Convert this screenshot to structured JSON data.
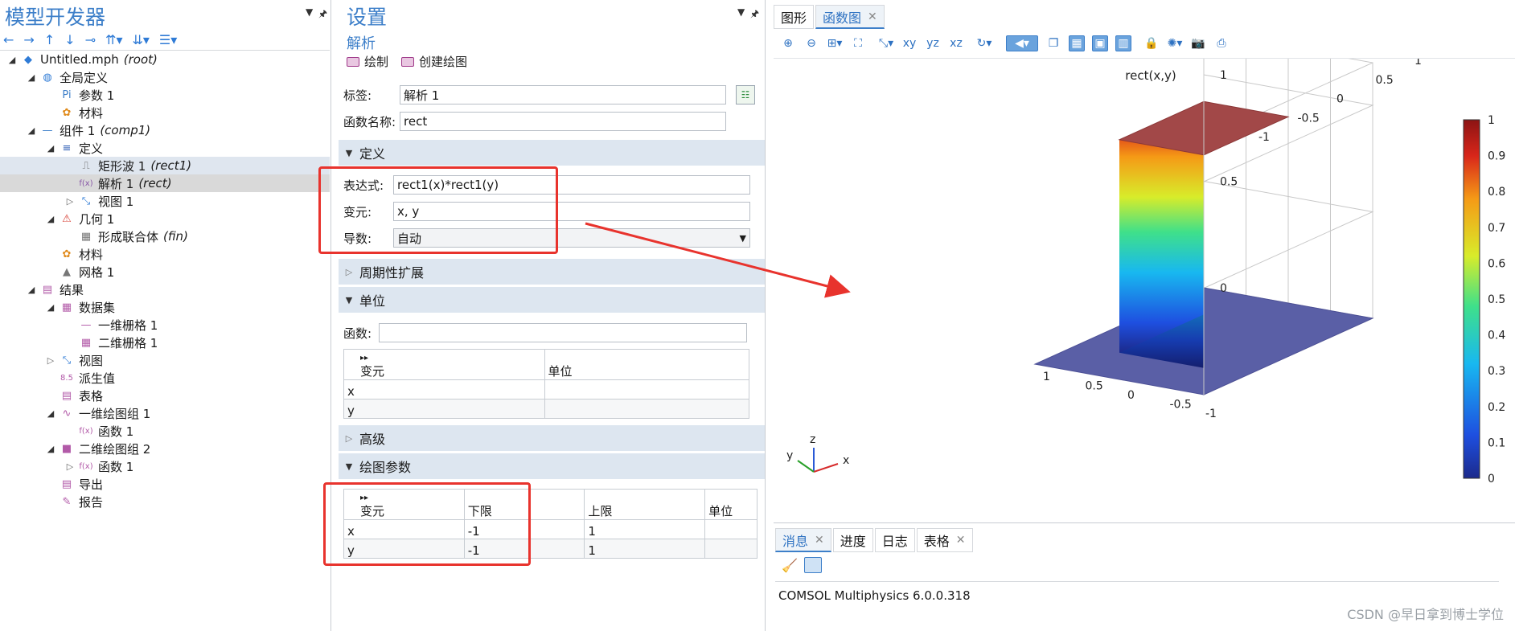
{
  "left": {
    "title": "模型开发器",
    "tree": [
      {
        "label": "Untitled.mph",
        "tag": "(root)",
        "level": 0,
        "open": true,
        "icon": "model-icon"
      },
      {
        "label": "全局定义",
        "tag": "",
        "level": 1,
        "open": true,
        "icon": "globe-icon"
      },
      {
        "label": "参数 1",
        "tag": "",
        "level": 2,
        "icon": "params-icon"
      },
      {
        "label": "材料",
        "tag": "",
        "level": 2,
        "icon": "materials-icon"
      },
      {
        "label": "组件 1",
        "tag": "(comp1)",
        "level": 1,
        "open": true,
        "icon": "component-icon"
      },
      {
        "label": "定义",
        "tag": "",
        "level": 2,
        "open": true,
        "icon": "definitions-icon"
      },
      {
        "label": "矩形波 1",
        "tag": "(rect1)",
        "level": 3,
        "icon": "rectangle-function-icon",
        "sel": "sel"
      },
      {
        "label": "解析 1",
        "tag": "(rect)",
        "level": 3,
        "icon": "analytic-function-icon",
        "sel": "sel2"
      },
      {
        "label": "视图 1",
        "tag": "",
        "level": 3,
        "open": false,
        "icon": "view-icon"
      },
      {
        "label": "几何 1",
        "tag": "",
        "level": 2,
        "open": true,
        "icon": "geometry-icon"
      },
      {
        "label": "形成联合体",
        "tag": "(fin)",
        "level": 3,
        "icon": "form-union-icon"
      },
      {
        "label": "材料",
        "tag": "",
        "level": 2,
        "icon": "materials-icon"
      },
      {
        "label": "网格 1",
        "tag": "",
        "level": 2,
        "icon": "mesh-icon"
      },
      {
        "label": "结果",
        "tag": "",
        "level": 1,
        "open": true,
        "icon": "results-icon"
      },
      {
        "label": "数据集",
        "tag": "",
        "level": 2,
        "open": true,
        "icon": "datasets-icon"
      },
      {
        "label": "一维栅格 1",
        "tag": "",
        "level": 3,
        "icon": "grid-1d-icon"
      },
      {
        "label": "二维栅格 1",
        "tag": "",
        "level": 3,
        "icon": "grid-2d-icon"
      },
      {
        "label": "视图",
        "tag": "",
        "level": 2,
        "open": false,
        "icon": "view-icon"
      },
      {
        "label": "派生值",
        "tag": "",
        "level": 2,
        "icon": "derived-values-icon"
      },
      {
        "label": "表格",
        "tag": "",
        "level": 2,
        "icon": "tables-icon"
      },
      {
        "label": "一维绘图组 1",
        "tag": "",
        "level": 2,
        "open": true,
        "icon": "plot-1d-icon"
      },
      {
        "label": "函数 1",
        "tag": "",
        "level": 3,
        "icon": "function-icon"
      },
      {
        "label": "二维绘图组 2",
        "tag": "",
        "level": 2,
        "open": true,
        "icon": "plot-2d-icon"
      },
      {
        "label": "函数 1",
        "tag": "",
        "level": 3,
        "open": false,
        "icon": "function-icon"
      },
      {
        "label": "导出",
        "tag": "",
        "level": 2,
        "icon": "export-icon"
      },
      {
        "label": "报告",
        "tag": "",
        "level": 2,
        "icon": "report-icon"
      }
    ]
  },
  "settings": {
    "title": "设置",
    "subtitle": "解析",
    "toolbar": {
      "plot": "绘制",
      "create_plot": "创建绘图"
    },
    "label_caption": "标签:",
    "label_value": "解析 1",
    "fname_caption": "函数名称:",
    "fname_value": "rect",
    "sections": {
      "definition": "定义",
      "periodic": "周期性扩展",
      "units": "单位",
      "advanced": "高级",
      "plot_params": "绘图参数"
    },
    "definition": {
      "expr_caption": "表达式:",
      "expr_value": "rect1(x)*rect1(y)",
      "args_caption": "变元:",
      "args_value": "x, y",
      "deriv_caption": "导数:",
      "deriv_value": "自动"
    },
    "units": {
      "func_caption": "函数:",
      "func_value": "",
      "headers": [
        "变元",
        "单位"
      ],
      "rows": [
        [
          "x",
          ""
        ],
        [
          "y",
          ""
        ]
      ]
    },
    "plot_params": {
      "headers": [
        "变元",
        "下限",
        "上限",
        "单位"
      ],
      "rows": [
        [
          "x",
          "-1",
          "1",
          ""
        ],
        [
          "y",
          "-1",
          "1",
          ""
        ]
      ]
    }
  },
  "graphics": {
    "tabs": [
      {
        "label": "图形",
        "closable": false
      },
      {
        "label": "函数图",
        "closable": true,
        "active": true
      }
    ],
    "plot_title": "rect(x,y)",
    "x_ticks": [
      "-1",
      "-0.5",
      "0",
      "0.5",
      "1"
    ],
    "y_ticks": [
      "1",
      "0.5",
      "0",
      "-0.5",
      "-1"
    ],
    "z_ticks": [
      "0",
      "0.5",
      "1"
    ],
    "colorbar": [
      "1",
      "0.9",
      "0.8",
      "0.7",
      "0.6",
      "0.5",
      "0.4",
      "0.3",
      "0.2",
      "0.1",
      "0"
    ],
    "axis_labels": {
      "x": "x",
      "y": "y",
      "z": "z"
    }
  },
  "messages": {
    "tabs": [
      {
        "label": "消息",
        "closable": true,
        "active": true
      },
      {
        "label": "进度"
      },
      {
        "label": "日志"
      },
      {
        "label": "表格",
        "closable": true
      }
    ],
    "text": "COMSOL Multiphysics 6.0.0.318"
  },
  "watermark": "CSDN @早日拿到博士学位",
  "colors": {
    "accent": "#3d7fc9",
    "annotation": "#e8332d"
  }
}
